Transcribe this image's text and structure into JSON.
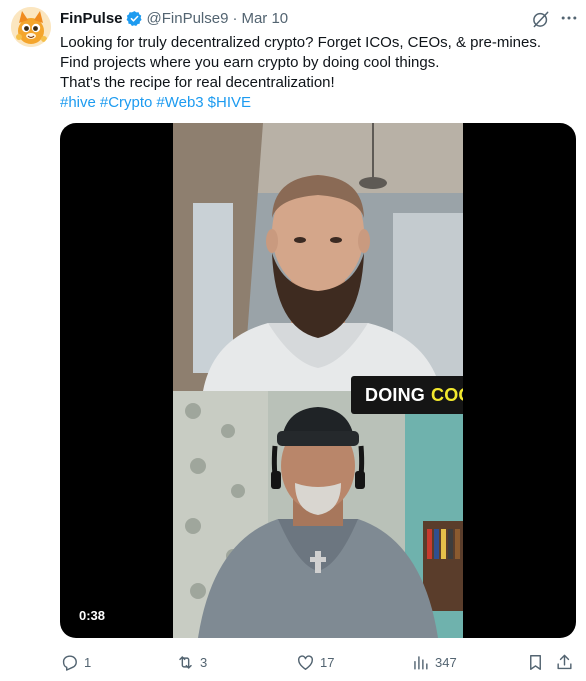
{
  "tweet": {
    "author_name": "FinPulse",
    "handle": "@FinPulse9",
    "separator": "·",
    "date": "Mar 10",
    "lines": [
      "Looking for truly decentralized crypto? Forget ICOs, CEOs, & pre-mines.",
      "Find projects where you earn crypto by doing cool things.",
      "That's the recipe for real decentralization!"
    ],
    "hashtags": [
      "#hive",
      "#Crypto",
      "#Web3",
      "$HIVE"
    ]
  },
  "video": {
    "caption_word1": "DOING",
    "caption_word2": "COOL",
    "timestamp": "0:38"
  },
  "actions": {
    "replies": "1",
    "reposts": "3",
    "likes": "17",
    "views": "347"
  },
  "icons": {
    "verified": "verified-badge-icon",
    "grok": "grok-icon",
    "more": "more-icon",
    "reply": "reply-icon",
    "repost": "repost-icon",
    "like": "like-icon",
    "views": "views-icon",
    "bookmark": "bookmark-icon",
    "share": "share-icon"
  },
  "colors": {
    "accent": "#1d9bf0",
    "muted": "#536471",
    "caption_highlight": "#f2e82e"
  }
}
